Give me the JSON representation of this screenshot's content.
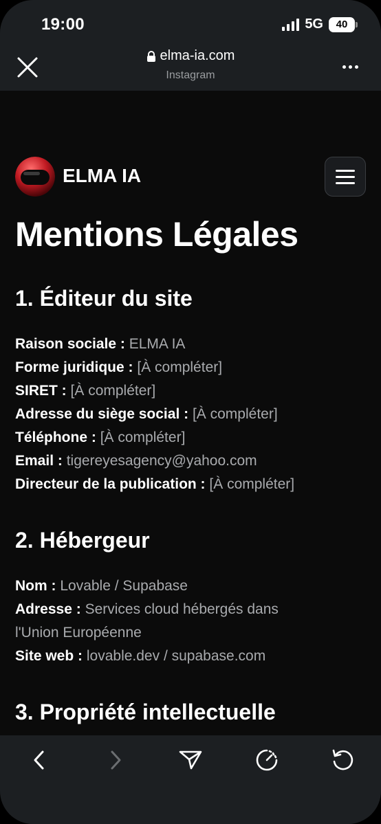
{
  "status": {
    "time": "19:00",
    "network": "5G",
    "battery": "40"
  },
  "browser": {
    "url": "elma-ia.com",
    "origin": "Instagram"
  },
  "site": {
    "brand": "ELMA IA"
  },
  "page": {
    "title": "Mentions Légales"
  },
  "sections": [
    {
      "title": "1. Éditeur du site",
      "rows": [
        {
          "label": "Raison sociale :",
          "value": "ELMA IA"
        },
        {
          "label": "Forme juridique :",
          "value": "[À compléter]"
        },
        {
          "label": "SIRET :",
          "value": "[À compléter]"
        },
        {
          "label": "Adresse du siège social :",
          "value": "[À compléter]"
        },
        {
          "label": "Téléphone :",
          "value": "[À compléter]"
        },
        {
          "label": "Email :",
          "value": "tigereyesagency@yahoo.com"
        },
        {
          "label": "Directeur de la publication :",
          "value": "[À compléter]"
        }
      ]
    },
    {
      "title": "2. Hébergeur",
      "rows": [
        {
          "label": "Nom :",
          "value": "Lovable / Supabase"
        },
        {
          "label": "Adresse :",
          "value": "Services cloud hébergés dans l'Union Européenne"
        },
        {
          "label": "Site web :",
          "value": "lovable.dev / supabase.com"
        }
      ]
    },
    {
      "title": "3. Propriété intellectuelle"
    }
  ],
  "icons": {
    "close": "close-icon",
    "lock": "lock-icon",
    "more": "more-icon",
    "menu": "hamburger-icon",
    "back": "chevron-left-icon",
    "forward": "chevron-right-icon",
    "share": "send-icon",
    "speed": "speed-icon",
    "reload": "reload-icon"
  },
  "colors": {
    "background": "#0b0b0b",
    "chrome": "#1c1f22",
    "muted_text": "#a9abae"
  }
}
